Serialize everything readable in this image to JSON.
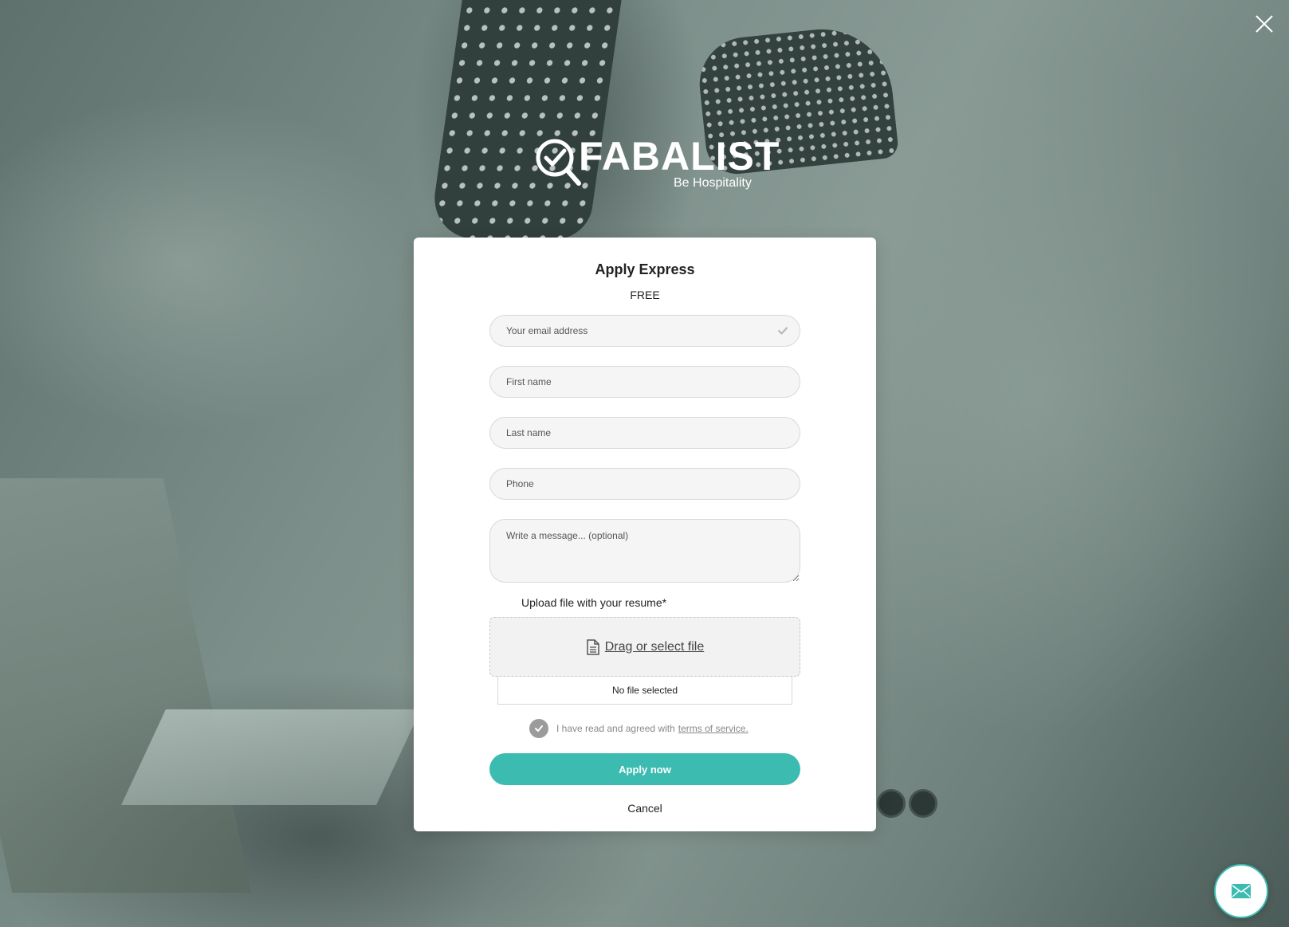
{
  "brand": {
    "name": "FABALIST",
    "tagline": "Be Hospitality"
  },
  "modal": {
    "title": "Apply Express",
    "subtitle": "FREE",
    "fields": {
      "email_placeholder": "Your email address",
      "first_name_placeholder": "First name",
      "last_name_placeholder": "Last name",
      "phone_placeholder": "Phone",
      "message_placeholder": "Write a message... (optional)"
    },
    "upload": {
      "label": "Upload file with your resume*",
      "dropzone_text": "Drag or select file",
      "status": "No file selected"
    },
    "terms": {
      "text": "I have read and agreed with",
      "link_text": "terms of service."
    },
    "apply_label": "Apply now",
    "cancel_label": "Cancel"
  },
  "icons": {
    "close": "close-icon",
    "email_check": "check-icon",
    "file": "file-icon",
    "terms_check": "check-icon",
    "mail": "mail-icon"
  },
  "colors": {
    "accent": "#3cbcb0",
    "modal_bg": "#ffffff",
    "field_bg": "#f5f5f5",
    "check_bg": "#9b9b9b"
  }
}
